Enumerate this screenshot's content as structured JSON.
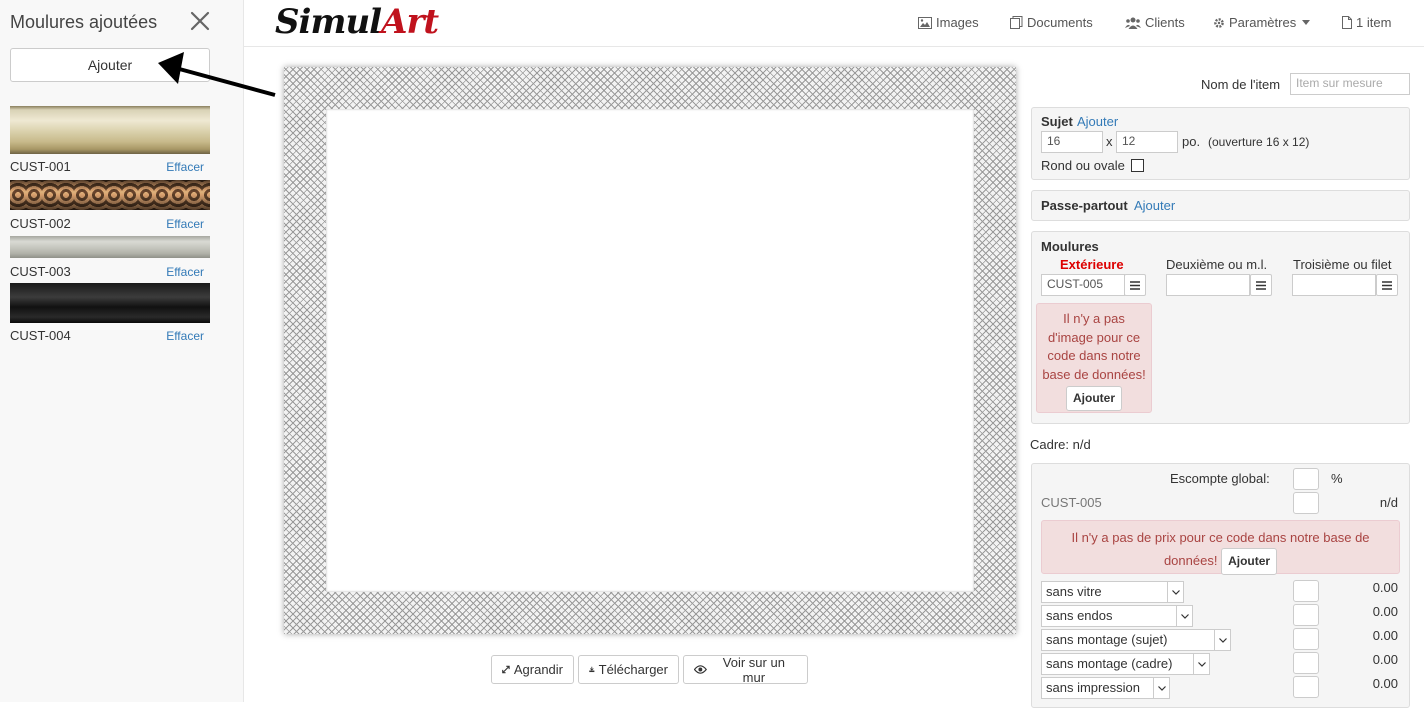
{
  "sidebar": {
    "title": "Moulures ajoutées",
    "add_label": "Ajouter",
    "delete_label": "Effacer",
    "items": [
      {
        "code": "CUST-001"
      },
      {
        "code": "CUST-002"
      },
      {
        "code": "CUST-003"
      },
      {
        "code": "CUST-004"
      }
    ]
  },
  "navbar": {
    "logo_a": "Simul",
    "logo_b": "Art",
    "images": "Images",
    "documents": "Documents",
    "clients": "Clients",
    "parametres": "Paramètres",
    "items": "1 item"
  },
  "canvas_buttons": {
    "enlarge": "Agrandir",
    "download": "Télécharger",
    "wall": "Voir sur un mur"
  },
  "item": {
    "name_label": "Nom de l'item",
    "name_placeholder": "Item sur mesure"
  },
  "sujet": {
    "title": "Sujet",
    "add": "Ajouter",
    "width": "16",
    "x": "x",
    "height": "12",
    "unit": "po.",
    "opening": "(ouverture 16 x 12)",
    "round_label": "Rond ou ovale"
  },
  "passe": {
    "title": "Passe-partout",
    "add": "Ajouter"
  },
  "moulures": {
    "title": "Moulures",
    "col1": "Extérieure",
    "col2": "Deuxième ou m.l.",
    "col3": "Troisième ou filet",
    "code1": "CUST-005",
    "no_image": "Il n'y a pas d'image pour ce code dans notre base de données!",
    "add": "Ajouter"
  },
  "cadre": "Cadre: n/d",
  "pricing": {
    "discount_label": "Escompte global:",
    "percent": "%",
    "code": "CUST-005",
    "code_price": "n/d",
    "no_price": "Il n'y a pas de prix pour ce code dans notre base de données!",
    "add": "Ajouter",
    "options": [
      {
        "label": "sans vitre",
        "price": "0.00"
      },
      {
        "label": "sans endos",
        "price": "0.00"
      },
      {
        "label": "sans montage (sujet)",
        "price": "0.00"
      },
      {
        "label": "sans montage (cadre)",
        "price": "0.00"
      },
      {
        "label": "sans impression",
        "price": "0.00"
      }
    ]
  }
}
